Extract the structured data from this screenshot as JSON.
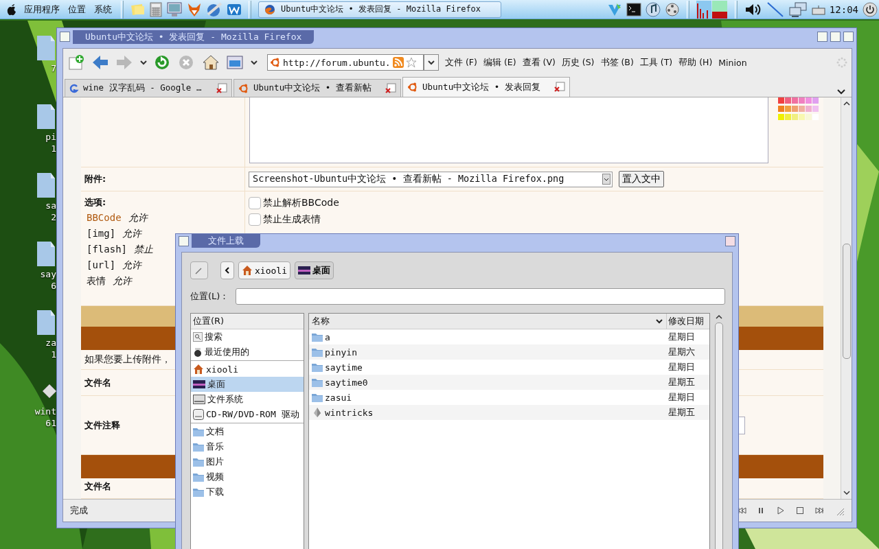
{
  "top_panel": {
    "menus": [
      "应用程序",
      "位置",
      "系统"
    ],
    "task": {
      "title": "Ubuntu中文论坛 • 发表回复 - Mozilla Firefox",
      "selected": true
    },
    "clock": "12:04"
  },
  "desktop_icons": [
    {
      "kind": "folder",
      "lines": [
        "7"
      ]
    },
    {
      "kind": "folder",
      "lines": [
        "pi",
        "1"
      ]
    },
    {
      "kind": "folder",
      "lines": [
        "sa",
        "2"
      ]
    },
    {
      "kind": "folder",
      "lines": [
        "say",
        "6"
      ]
    },
    {
      "kind": "folder",
      "lines": [
        "za",
        "1"
      ]
    },
    {
      "kind": "file",
      "lines": [
        "wint",
        "61"
      ]
    }
  ],
  "browser": {
    "title": "Ubuntu中文论坛 • 发表回复 - Mozilla Firefox",
    "url": "http://forum.ubuntu.",
    "menus": [
      "文件 (F)",
      "编辑 (E)",
      "查看 (V)",
      "历史 (S)",
      "书签 (B)",
      "工具 (T)",
      "帮助 (H)",
      "Minion"
    ],
    "tabs": [
      {
        "label": "wine 汉字乱码 - Google …",
        "kind": "google",
        "selected": false
      },
      {
        "label": "Ubuntu中文论坛 • 查看新帖",
        "kind": "ubuntu",
        "selected": false
      },
      {
        "label": "Ubuntu中文论坛 • 发表回复",
        "kind": "ubuntu",
        "selected": true
      }
    ],
    "form": {
      "attachment_label": "附件:",
      "file_select": "Screenshot-Ubuntu中文论坛 • 查看新帖 - Mozilla Firefox.png",
      "insert_button": "置入文中",
      "options_label": "选项:",
      "options": [
        {
          "name": "BBCode",
          "kind": "link",
          "value": "允许"
        },
        {
          "name": "[img]",
          "kind": "plain",
          "value": "允许"
        },
        {
          "name": "[flash]",
          "kind": "plain",
          "value": "禁止"
        },
        {
          "name": "[url]",
          "kind": "plain",
          "value": "允许"
        },
        {
          "name": "表情",
          "kind": "plain",
          "value": "允许"
        }
      ],
      "checkboxes": [
        {
          "label": "禁止解析BBCode",
          "checked": false
        },
        {
          "label": "禁止生成表情",
          "checked": false
        }
      ],
      "upload_note": "如果您要上传附件，",
      "filename_label": "文件名",
      "comment_label": "文件注释",
      "filename_label_2": "文件名"
    },
    "status": "完成"
  },
  "dialog": {
    "title": "文件上载",
    "path": [
      {
        "label": "xiooli",
        "kind": "home",
        "selected": false
      },
      {
        "label": "桌面",
        "kind": "desktop",
        "selected": true
      }
    ],
    "location_label": "位置(L)：",
    "places_header": "位置(R)",
    "place_groups": [
      [
        {
          "label": "搜索",
          "kind": "search",
          "selected": false
        },
        {
          "label": "最近使用的",
          "kind": "recent",
          "selected": false
        }
      ],
      [
        {
          "label": "xiooli",
          "kind": "home",
          "selected": false
        },
        {
          "label": "桌面",
          "kind": "desktop",
          "selected": true
        },
        {
          "label": "文件系统",
          "kind": "drive",
          "selected": false
        },
        {
          "label": "CD-RW/DVD-ROM 驱动",
          "kind": "cdrom",
          "selected": false
        }
      ],
      [
        {
          "label": "文档",
          "kind": "folder",
          "selected": false
        },
        {
          "label": "音乐",
          "kind": "folder",
          "selected": false
        },
        {
          "label": "图片",
          "kind": "folder",
          "selected": false
        },
        {
          "label": "视频",
          "kind": "folder",
          "selected": false
        },
        {
          "label": "下载",
          "kind": "folder",
          "selected": false
        }
      ]
    ],
    "columns": [
      "名称",
      "修改日期"
    ],
    "files": [
      {
        "name": "a",
        "kind": "folder",
        "modified": "星期日"
      },
      {
        "name": "pinyin",
        "kind": "folder",
        "modified": "星期六"
      },
      {
        "name": "saytime",
        "kind": "folder",
        "modified": "星期日"
      },
      {
        "name": "saytime0",
        "kind": "folder",
        "modified": "星期五"
      },
      {
        "name": "zasui",
        "kind": "folder",
        "modified": "星期日"
      },
      {
        "name": "wintricks",
        "kind": "file",
        "modified": "星期五"
      }
    ]
  }
}
